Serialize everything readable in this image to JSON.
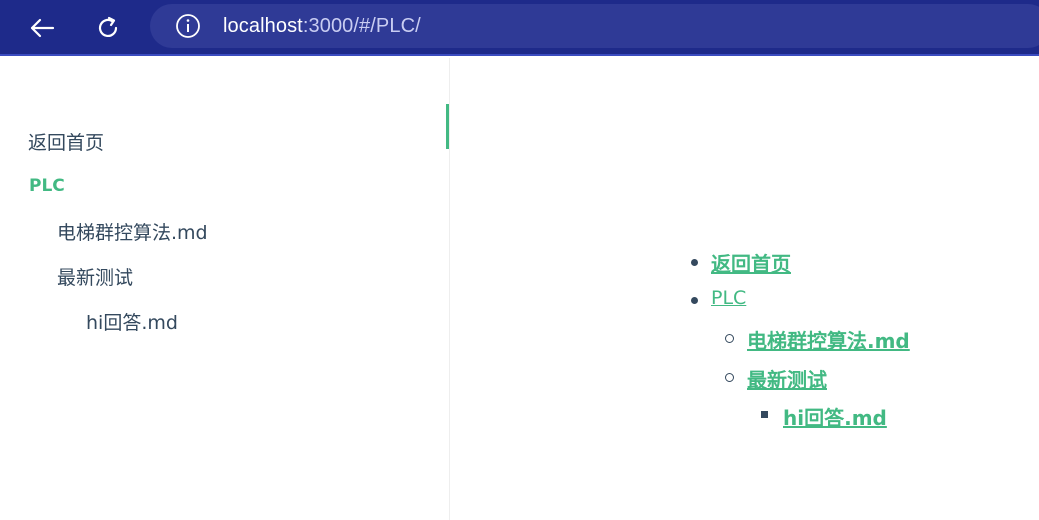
{
  "browser": {
    "url_host": "localhost",
    "url_rest": ":3000/#/PLC/"
  },
  "sidebar": {
    "items": [
      {
        "label": "返回首页"
      },
      {
        "label": "PLC"
      },
      {
        "label": "电梯群控算法.md"
      },
      {
        "label": "最新测试"
      },
      {
        "label": "hi回答.md"
      }
    ]
  },
  "content": {
    "toc": [
      {
        "label": "返回首页"
      },
      {
        "label": "PLC"
      },
      {
        "label": "电梯群控算法.md"
      },
      {
        "label": "最新测试"
      },
      {
        "label": "hi回答.md"
      }
    ]
  },
  "colors": {
    "accent": "#42b983",
    "text": "#34495e",
    "browser_bar": "#1e2a8a"
  }
}
